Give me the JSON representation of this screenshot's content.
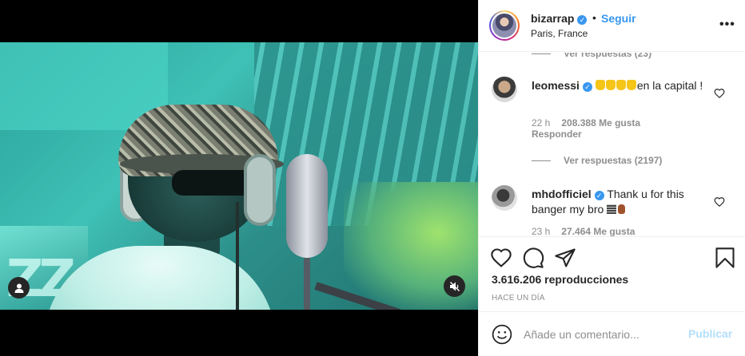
{
  "post": {
    "owner": {
      "username": "bizarrap",
      "verified": true,
      "follow_label": "Seguir",
      "separator": "•",
      "location": "Paris, France"
    },
    "more_label": "•••"
  },
  "comments": {
    "top_replies_label": "Ver respuestas (23)",
    "items": [
      {
        "username": "leomessi",
        "verified": true,
        "text": "en la capital !",
        "emoji": "👏👏👏👏",
        "time": "22 h",
        "likes": "208.388 Me gusta",
        "reply_label": "Responder",
        "replies_label": "Ver respuestas (2197)"
      },
      {
        "username": "mhdofficiel",
        "verified": true,
        "text": "Thank u for this banger my bro",
        "emoji": "🎚✌🏾",
        "time": "23 h",
        "likes": "27.464 Me gusta"
      }
    ]
  },
  "stats": {
    "views": "3.616.206 reproducciones",
    "time_ago": "Hace un día"
  },
  "composer": {
    "placeholder": "Añade un comentario...",
    "post_label": "Publicar"
  },
  "icons": {
    "like": "heart-icon",
    "comment": "comment-icon",
    "share": "share-icon",
    "save": "bookmark-icon",
    "emoji": "smile-icon",
    "tag": "user-tag-icon",
    "mute": "muted-speaker-icon"
  },
  "colors": {
    "link_blue": "#3897f0",
    "muted_text": "#8e8e8e",
    "post_disabled": "#b2dffc",
    "border": "#efefef"
  }
}
